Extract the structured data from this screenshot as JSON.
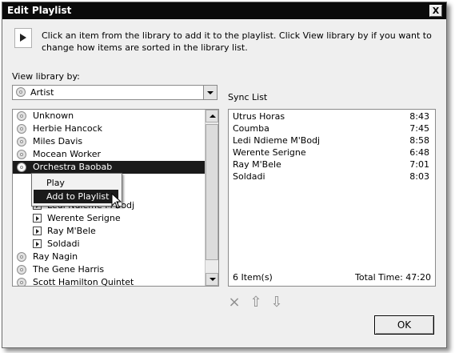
{
  "dialog": {
    "title": "Edit Playlist",
    "close_label": "X",
    "instructions": "Click an item from the library to add it to the playlist. Click View library by if you want to change how items are sorted in the library list.",
    "view_by_label": "View library by:",
    "view_by_value": "Artist",
    "sync_list_label": "Sync List",
    "ok_label": "OK"
  },
  "library": {
    "items_before": [
      {
        "label": "Unknown"
      },
      {
        "label": "Herbie Hancock"
      },
      {
        "label": "Miles Davis"
      },
      {
        "label": "Mocean Worker"
      }
    ],
    "selected": {
      "label": "Orchestra Baobab"
    },
    "tracks": [
      {
        "label": "Utrus Horas"
      },
      {
        "label": "Coumba"
      },
      {
        "label": "Ledi Ndieme M'Bodj"
      },
      {
        "label": "Werente Serigne"
      },
      {
        "label": "Ray M'Bele"
      },
      {
        "label": "Soldadi"
      }
    ],
    "items_after": [
      {
        "label": "Ray Nagin"
      },
      {
        "label": "The Gene Harris"
      },
      {
        "label": "Scott Hamilton Quintet"
      }
    ]
  },
  "context_menu": {
    "items": [
      {
        "label": "Play"
      },
      {
        "label": "Add to Playlist"
      }
    ]
  },
  "sync_list": {
    "rows": [
      {
        "name": "Utrus Horas",
        "time": "8:43"
      },
      {
        "name": "Coumba",
        "time": "7:45"
      },
      {
        "name": "Ledi Ndieme M'Bodj",
        "time": "8:58"
      },
      {
        "name": "Werente Serigne",
        "time": "6:48"
      },
      {
        "name": "Ray M'Bele",
        "time": "7:01"
      },
      {
        "name": "Soldadi",
        "time": "8:03"
      }
    ],
    "count": "6 Item(s)",
    "total": "Total Time: 47:20"
  },
  "icons": {
    "delete": "×",
    "move_up": "⇧",
    "move_down": "⇩"
  }
}
